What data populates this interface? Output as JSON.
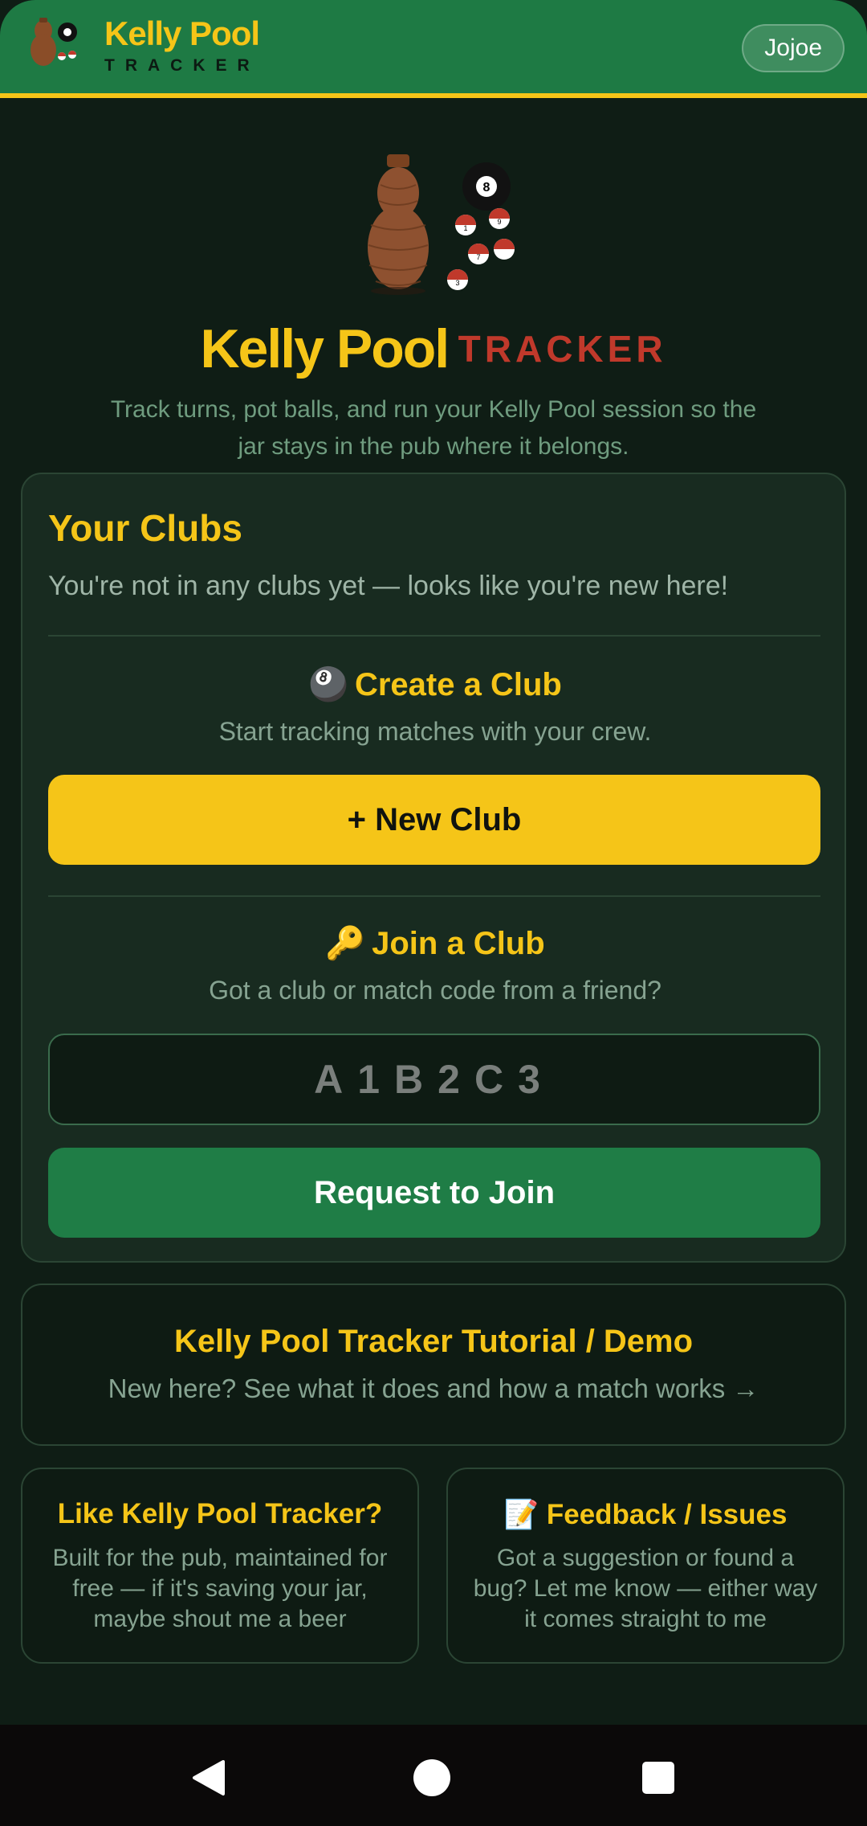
{
  "header": {
    "brand_name": "Kelly Pool",
    "brand_sub": "TRACKER",
    "user_name": "Jojoe"
  },
  "hero": {
    "title_main": "Kelly Pool",
    "title_accent": "TRACKER",
    "tagline": "Track turns, pot balls, and run your Kelly Pool session so the jar stays in the pub where it belongs.",
    "ball_numbers": [
      "8",
      "1",
      "9",
      "7",
      "3"
    ]
  },
  "clubs": {
    "title": "Your Clubs",
    "empty_message": "You're not in any clubs yet — looks like you're new here!",
    "create": {
      "emoji": "🎱",
      "title": "Create a Club",
      "subtitle": "Start tracking matches with your crew.",
      "button_label": "+ New Club"
    },
    "join": {
      "emoji": "🔑",
      "title": "Join a Club",
      "subtitle": "Got a club or match code from a friend?",
      "code_placeholder": "A1B2C3",
      "button_label": "Request to Join"
    }
  },
  "tutorial": {
    "title": "Kelly Pool Tracker Tutorial / Demo",
    "subtitle": "New here? See what it does and how a match works →"
  },
  "support": {
    "title": "Like Kelly Pool Tracker?",
    "subtitle": "Built for the pub, maintained for free — if it's saving your jar, maybe shout me a beer"
  },
  "feedback": {
    "emoji": "📝",
    "title": "Feedback / Issues",
    "subtitle": "Got a suggestion or found a bug? Let me know — either way it comes straight to me"
  },
  "nav": {
    "back_icon": "back-triangle",
    "home_icon": "home-circle",
    "recent_icon": "recent-square"
  },
  "colors": {
    "accent": "#f5c518",
    "header_green": "#1e7a44",
    "button_green": "#1f7d46",
    "tracker_red": "#c0392b",
    "background": "#0f1d15"
  }
}
